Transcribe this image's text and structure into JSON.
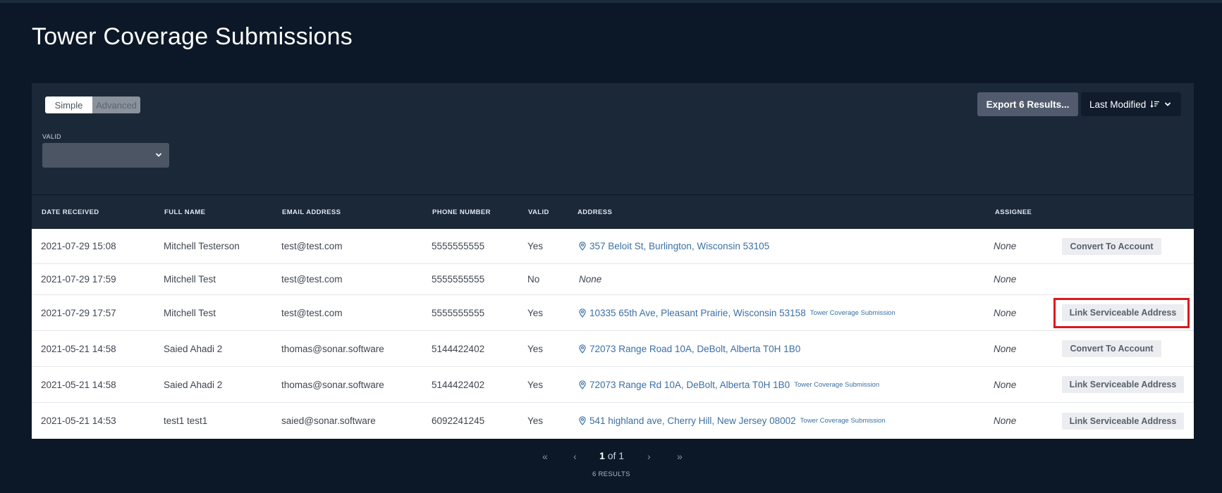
{
  "page": {
    "title": "Tower Coverage Submissions"
  },
  "filters": {
    "mode_simple": "Simple",
    "mode_advanced": "Advanced",
    "valid_label": "VALID",
    "valid_value": ""
  },
  "toolbar": {
    "export_label": "Export 6 Results...",
    "sort_label": "Last Modified"
  },
  "table": {
    "headers": {
      "date_received": "DATE RECEIVED",
      "full_name": "FULL NAME",
      "email_address": "EMAIL ADDRESS",
      "phone_number": "PHONE NUMBER",
      "valid": "VALID",
      "address": "ADDRESS",
      "assignee": "ASSIGNEE"
    },
    "rows": [
      {
        "date": "2021-07-29 15:08",
        "name": "Mitchell Testerson",
        "email": "test@test.com",
        "phone": "5555555555",
        "valid": "Yes",
        "address": "357 Beloit St, Burlington, Wisconsin 53105",
        "tag": "",
        "assignee": "None",
        "action": "Convert To Account"
      },
      {
        "date": "2021-07-29 17:59",
        "name": "Mitchell Test",
        "email": "test@test.com",
        "phone": "5555555555",
        "valid": "No",
        "address": "None",
        "tag": "",
        "assignee": "None",
        "action": ""
      },
      {
        "date": "2021-07-29 17:57",
        "name": "Mitchell Test",
        "email": "test@test.com",
        "phone": "5555555555",
        "valid": "Yes",
        "address": "10335 65th Ave, Pleasant Prairie, Wisconsin 53158",
        "tag": "Tower Coverage Submission",
        "assignee": "None",
        "action": "Link Serviceable Address"
      },
      {
        "date": "2021-05-21 14:58",
        "name": "Saied Ahadi 2",
        "email": "thomas@sonar.software",
        "phone": "5144422402",
        "valid": "Yes",
        "address": "72073 Range Road 10A, DeBolt, Alberta T0H 1B0",
        "tag": "",
        "assignee": "None",
        "action": "Convert To Account"
      },
      {
        "date": "2021-05-21 14:58",
        "name": "Saied Ahadi 2",
        "email": "thomas@sonar.software",
        "phone": "5144422402",
        "valid": "Yes",
        "address": "72073 Range Rd 10A, DeBolt, Alberta T0H 1B0",
        "tag": "Tower Coverage Submission",
        "assignee": "None",
        "action": "Link Serviceable Address"
      },
      {
        "date": "2021-05-21 14:53",
        "name": "test1 test1",
        "email": "saied@sonar.software",
        "phone": "6092241245",
        "valid": "Yes",
        "address": "541 highland ave, Cherry Hill, New Jersey 08002",
        "tag": "Tower Coverage Submission",
        "assignee": "None",
        "action": "Link Serviceable Address"
      }
    ]
  },
  "pagination": {
    "first": "«",
    "prev": "‹",
    "current": "1",
    "of_text": "of 1",
    "next": "›",
    "last": "»",
    "results": "6 RESULTS"
  },
  "icons": {
    "location": "map-pin-icon",
    "chevron": "chevron-down-icon",
    "sort": "sort-descending-icon"
  },
  "colors": {
    "background": "#0c1827",
    "panel": "#1a2838",
    "link": "#3b6fa3",
    "highlight": "#e0161b"
  }
}
